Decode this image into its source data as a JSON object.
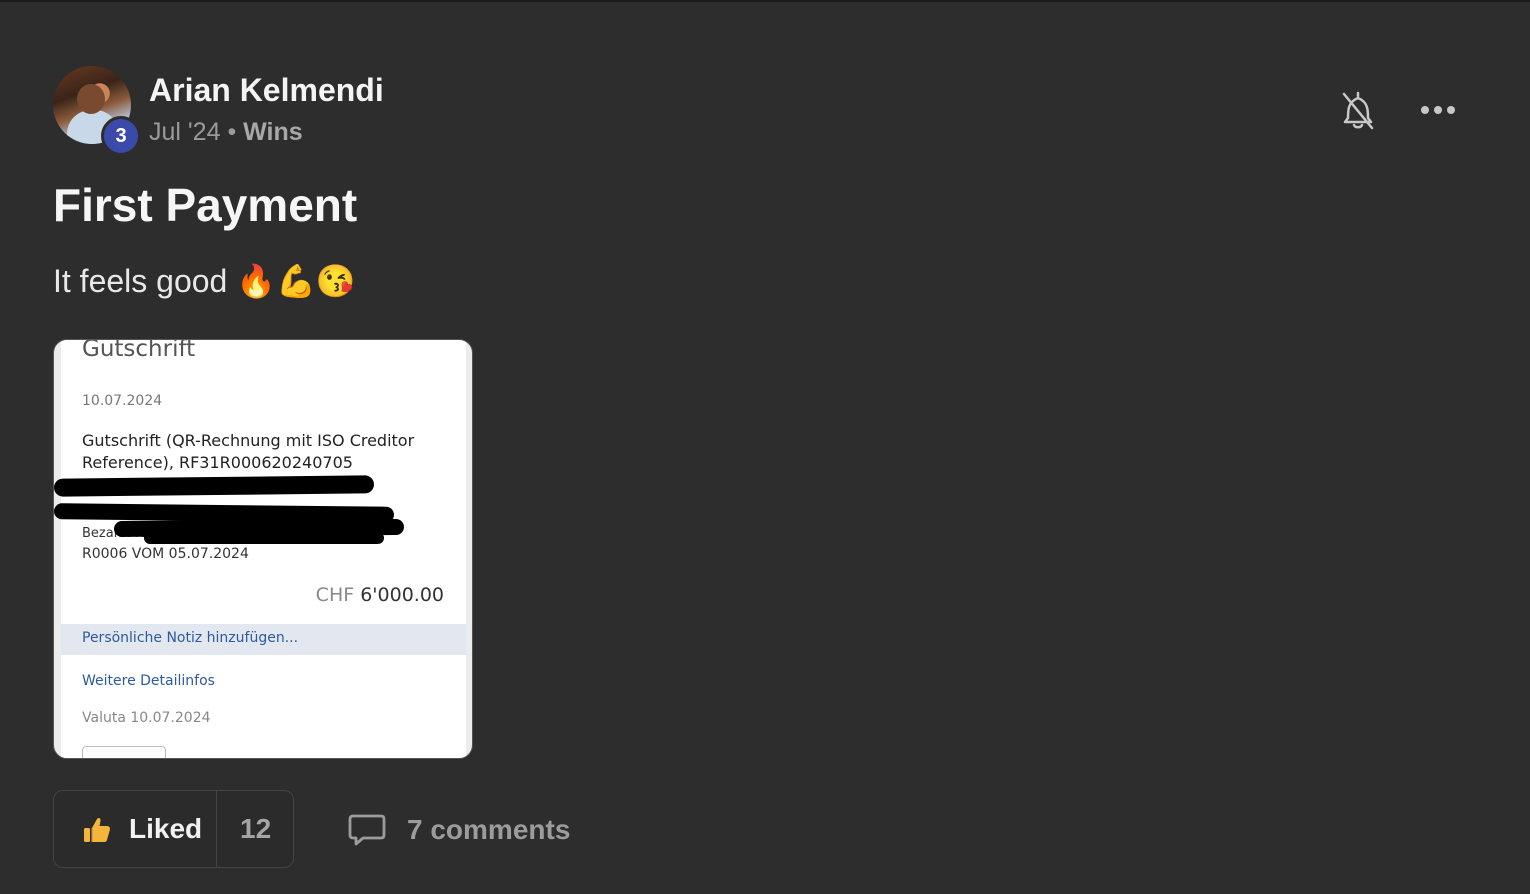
{
  "post": {
    "author": "Arian Kelmendi",
    "level": "3",
    "date": "Jul '24",
    "separator": "•",
    "category": "Wins",
    "title": "First Payment",
    "body": "It feels good 🔥💪😘"
  },
  "receipt": {
    "heading": "Gutschrift",
    "date": "10.07.2024",
    "description": "Gutschrift (QR-Rechnung mit ISO Creditor Reference), RF31R000620240705",
    "paid_for": "Bezahlt für:",
    "reference": "R0006 VOM 05.07.2024",
    "currency": "CHF",
    "amount": "6'000.00",
    "note_link": "Persönliche Notiz hinzufügen...",
    "details_link": "Weitere Detailinfos",
    "valuta": "Valuta 10.07.2024"
  },
  "actions": {
    "like_label": "Liked",
    "like_count": "12",
    "comments_label": "7 comments"
  },
  "icons": {
    "bell": "bell-off-icon",
    "more": "more-horizontal-icon",
    "like": "thumbs-up-icon",
    "comment": "comment-bubble-icon"
  },
  "colors": {
    "background": "#2d2d2d",
    "level_badge": "#3b4aa8",
    "link_blue": "#2c5a9a"
  }
}
